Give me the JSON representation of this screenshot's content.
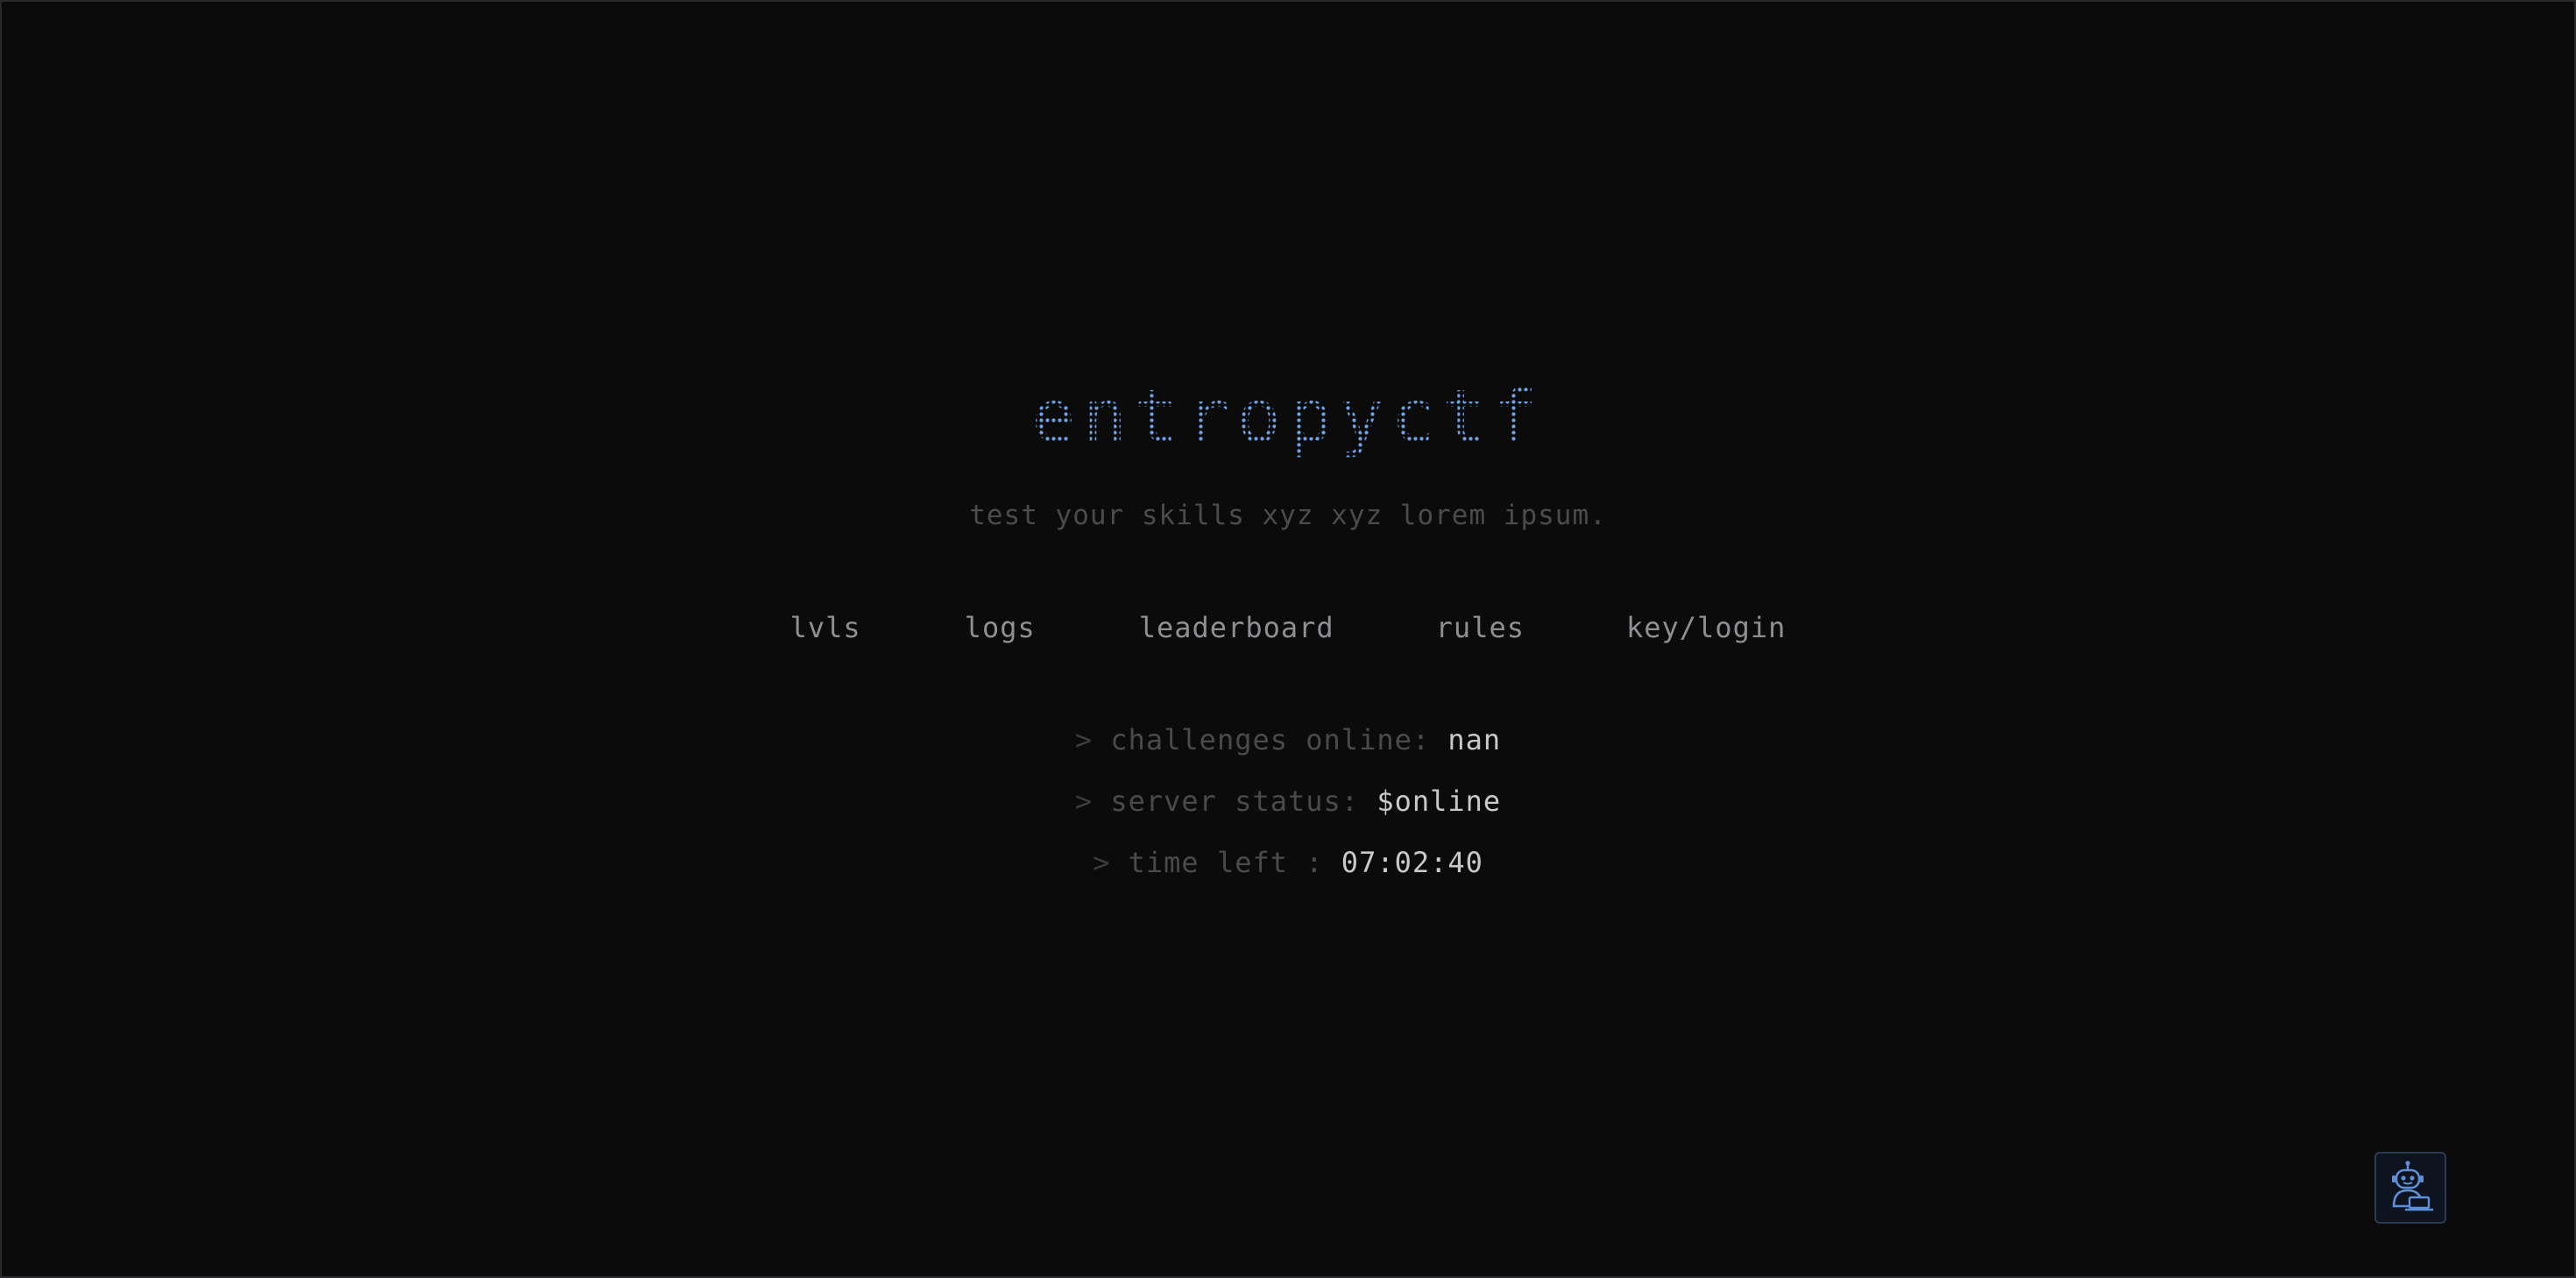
{
  "site": {
    "logo_text": "entropyctf",
    "tagline": "test your skills xyz xyz lorem ipsum."
  },
  "nav": {
    "items": [
      {
        "label": "lvls"
      },
      {
        "label": "logs"
      },
      {
        "label": "leaderboard"
      },
      {
        "label": "rules"
      },
      {
        "label": "key/login"
      }
    ]
  },
  "status": {
    "prompt": ">",
    "challenges_label": "challenges online:",
    "challenges_value": "nan",
    "server_label": "server status:",
    "server_value": "$online",
    "time_label": "time left :",
    "time_value": "07:02:40"
  },
  "assistant": {
    "icon": "robot-icon"
  },
  "colors": {
    "background": "#0b0b0c",
    "logo": "#6ea4e6",
    "nav_text": "#8f8f93",
    "dim_text": "#4a4a4d",
    "value_text": "#c9c9cc"
  }
}
